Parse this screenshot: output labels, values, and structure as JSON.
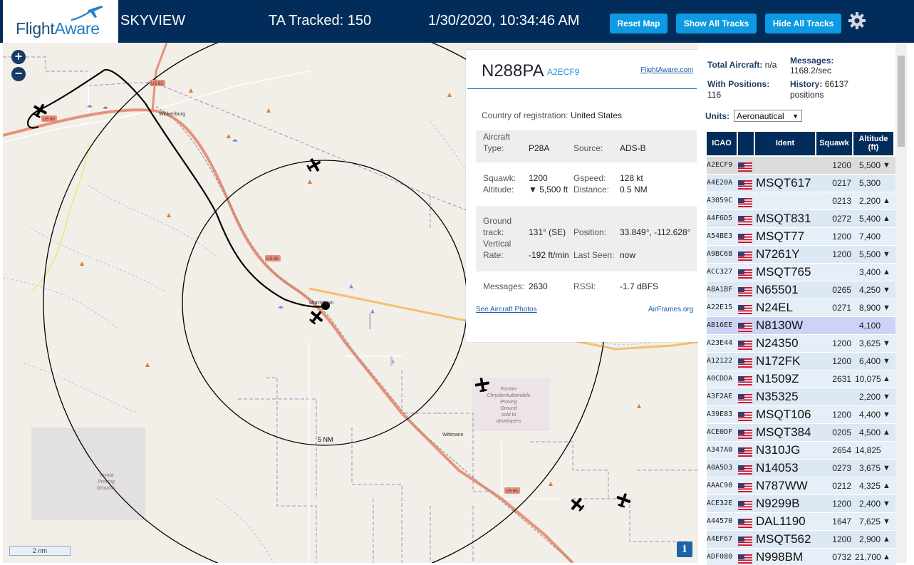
{
  "header": {
    "logo_part1": "Flight",
    "logo_part2": "Aware",
    "title": "SKYVIEW",
    "tracked": "TA Tracked: 150",
    "datetime": "1/30/2020, 10:34:46 AM",
    "btn_reset": "Reset Map",
    "btn_show": "Show All Tracks",
    "btn_hide": "Hide All Tracks",
    "gear_icon": "gear-icon"
  },
  "map": {
    "zoom_in": "+",
    "zoom_out": "−",
    "range_label": "5 NM",
    "scale_label": "2 nm",
    "info_label": "i",
    "place_labels": {
      "wickenburg": "Wickenburg",
      "morristown": "Morristown",
      "wittmann": "Wittmann",
      "us60a": "US 60",
      "us60b": "US 60",
      "us60c": "US 60",
      "us93": "US 93",
      "former_auto_1": "Former",
      "former_auto_2": "ChryslerAutomobile",
      "former_auto_3": "Proving",
      "former_auto_4": "Ground",
      "former_auto_5": "sold to",
      "former_auto_6": "developers",
      "toyota_1": "Toyota",
      "toyota_2": "Proving",
      "toyota_3": "Grounds"
    }
  },
  "popup": {
    "ident": "N288PA",
    "hex": "A2ECF9",
    "fa_link": "FlightAware.com",
    "country_label": "Country of registration:",
    "country_value": "United States",
    "aircraft_type_label_1": "Aircraft",
    "aircraft_type_label_2": "Type:",
    "aircraft_type": "P28A",
    "source_label": "Source:",
    "source": "ADS-B",
    "squawk_label": "Squawk:",
    "squawk": "1200",
    "gspeed_label": "Gspeed:",
    "gspeed": "128 kt",
    "altitude_label": "Altitude:",
    "altitude": "▼ 5,500 ft",
    "distance_label": "Distance:",
    "distance": "0.5 NM",
    "ground_label_1": "Ground",
    "ground_label_2": "track:",
    "ground_track": "131° (SE)",
    "position_label": "Position:",
    "position": "33.849°, -112.628°",
    "vrate_label_1": "Vertical",
    "vrate_label_2": "Rate:",
    "vrate": "-192 ft/min",
    "lastseen_label": "Last Seen:",
    "lastseen": "now",
    "messages_label": "Messages:",
    "messages": "2630",
    "rssi_label": "RSSI:",
    "rssi": "-1.7 dBFS",
    "photos_link": "See Aircraft Photos",
    "airframes_link": "AirFrames.org"
  },
  "panel": {
    "total_label": "Total Aircraft:",
    "total_value": "n/a",
    "messages_label": "Messages:",
    "messages_value": "1168.2/sec",
    "withpos_label": "With Positions:",
    "withpos_value": "116",
    "history_label": "History:",
    "history_value": "66137",
    "history_unit": "positions",
    "units_label": "Units:",
    "units_value": "Aeronautical",
    "col_icao": "ICAO",
    "col_ident": "Ident",
    "col_squawk": "Squawk",
    "col_alt_1": "Altitude",
    "col_alt_2": "(ft)",
    "rows": [
      {
        "icao": "A2ECF9",
        "ident": "",
        "squawk": "1200",
        "alt": "5,500",
        "vr": "▼",
        "hl": "selected"
      },
      {
        "icao": "A4E20A",
        "ident": "MSQT617",
        "squawk": "0217",
        "alt": "5,300",
        "vr": "",
        "hl": ""
      },
      {
        "icao": "A3059C",
        "ident": "",
        "squawk": "0213",
        "alt": "2,200",
        "vr": "▲",
        "hl": ""
      },
      {
        "icao": "A4F6D5",
        "ident": "MSQT831",
        "squawk": "0272",
        "alt": "5,400",
        "vr": "▲",
        "hl": ""
      },
      {
        "icao": "A54BE3",
        "ident": "MSQT77",
        "squawk": "1200",
        "alt": "7,400",
        "vr": "",
        "hl": ""
      },
      {
        "icao": "A9BC68",
        "ident": "N7261Y",
        "squawk": "1200",
        "alt": "5,500",
        "vr": "▼",
        "hl": ""
      },
      {
        "icao": "ACC327",
        "ident": "MSQT765",
        "squawk": "",
        "alt": "3,400",
        "vr": "▲",
        "hl": ""
      },
      {
        "icao": "A8A1BF",
        "ident": "N65501",
        "squawk": "0265",
        "alt": "4,250",
        "vr": "▼",
        "hl": ""
      },
      {
        "icao": "A22E15",
        "ident": "N24EL",
        "squawk": "0271",
        "alt": "8,900",
        "vr": "▼",
        "hl": ""
      },
      {
        "icao": "AB16EE",
        "ident": "N8130W",
        "squawk": "",
        "alt": "4,100",
        "vr": "",
        "hl": "hover"
      },
      {
        "icao": "A23E44",
        "ident": "N24350",
        "squawk": "1200",
        "alt": "3,625",
        "vr": "▼",
        "hl": ""
      },
      {
        "icao": "A12122",
        "ident": "N172FK",
        "squawk": "1200",
        "alt": "6,400",
        "vr": "▼",
        "hl": ""
      },
      {
        "icao": "A0CDDA",
        "ident": "N1509Z",
        "squawk": "2631",
        "alt": "10,075",
        "vr": "▲",
        "hl": ""
      },
      {
        "icao": "A3F2AE",
        "ident": "N35325",
        "squawk": "",
        "alt": "2,200",
        "vr": "▼",
        "hl": ""
      },
      {
        "icao": "A39E83",
        "ident": "MSQT106",
        "squawk": "1200",
        "alt": "4,400",
        "vr": "▼",
        "hl": ""
      },
      {
        "icao": "ACE0DF",
        "ident": "MSQT384",
        "squawk": "0205",
        "alt": "4,500",
        "vr": "▲",
        "hl": ""
      },
      {
        "icao": "A347A0",
        "ident": "N310JG",
        "squawk": "2654",
        "alt": "14,825",
        "vr": "",
        "hl": ""
      },
      {
        "icao": "A0A5D3",
        "ident": "N14053",
        "squawk": "0273",
        "alt": "3,675",
        "vr": "▼",
        "hl": ""
      },
      {
        "icao": "AAAC90",
        "ident": "N787WW",
        "squawk": "0212",
        "alt": "4,325",
        "vr": "▲",
        "hl": ""
      },
      {
        "icao": "ACE32E",
        "ident": "N9299B",
        "squawk": "1200",
        "alt": "2,400",
        "vr": "▼",
        "hl": ""
      },
      {
        "icao": "A44570",
        "ident": "DAL1190",
        "squawk": "1647",
        "alt": "7,625",
        "vr": "▼",
        "hl": ""
      },
      {
        "icao": "A4EF67",
        "ident": "MSQT562",
        "squawk": "1200",
        "alt": "2,900",
        "vr": "▲",
        "hl": ""
      },
      {
        "icao": "ADF080",
        "ident": "N998BM",
        "squawk": "0732",
        "alt": "21,700",
        "vr": "▲",
        "hl": ""
      }
    ]
  },
  "colors": {
    "header_bg": "#022d5a",
    "button_bg": "#0d9ae2",
    "row_even": "#e6eef8",
    "row_odd": "#dde8f5",
    "row_selected": "#dcdcdc",
    "row_hover": "#cdd3f5"
  }
}
